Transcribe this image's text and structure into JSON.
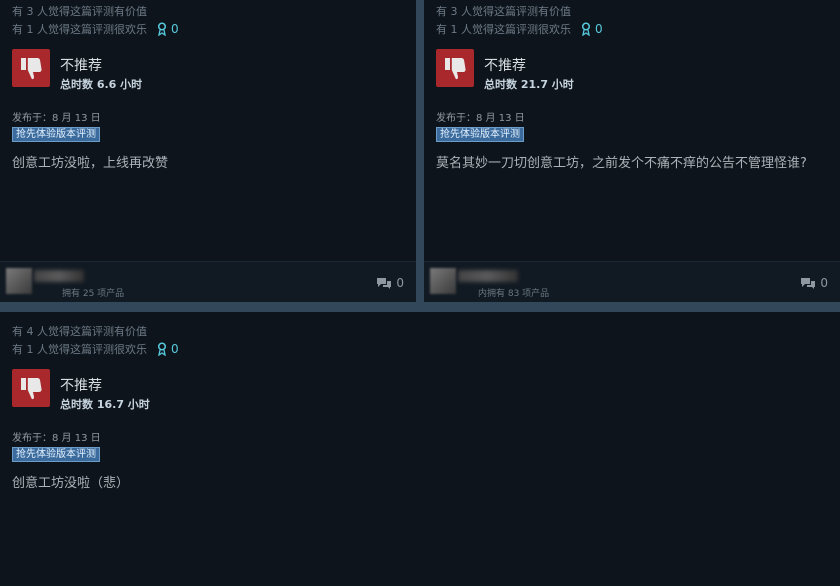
{
  "reviews": [
    {
      "helpful": "有 3 人觉得这篇评测有价值",
      "funny": "有 1 人觉得这篇评测很欢乐",
      "awards": "0",
      "verdict": "不推荐",
      "hours": "总时数 6.6 小时",
      "posted": "发布于：8 月 13 日",
      "badge": "抢先体验版本评测",
      "text": "创意工坊没啦，上线再改赞",
      "owned": "拥有 25 项产品",
      "comments": "0"
    },
    {
      "helpful": "有 3 人觉得这篇评测有价值",
      "funny": "有 1 人觉得这篇评测很欢乐",
      "awards": "0",
      "verdict": "不推荐",
      "hours": "总时数 21.7 小时",
      "posted": "发布于：8 月 13 日",
      "badge": "抢先体验版本评测",
      "text": "莫名其妙一刀切创意工坊，之前发个不痛不痒的公告不管理怪谁?",
      "owned": "内拥有 83 项产品",
      "comments": "0"
    },
    {
      "helpful": "有 4 人觉得这篇评测有价值",
      "funny": "有 1 人觉得这篇评测很欢乐",
      "awards": "0",
      "verdict": "不推荐",
      "hours": "总时数 16.7 小时",
      "posted": "发布于：8 月 13 日",
      "badge": "抢先体验版本评测",
      "text": "创意工坊没啦（悲）"
    }
  ],
  "colors": {
    "page_bg": "#33475a",
    "card_bg": "#0e141b",
    "thumb_red": "#a8282c",
    "award_blue": "#57cbde",
    "badge_blue": "#3a6b9c"
  },
  "icons": {
    "thumb": "thumbs-down-icon",
    "award": "award-icon",
    "comment": "comment-icon"
  }
}
